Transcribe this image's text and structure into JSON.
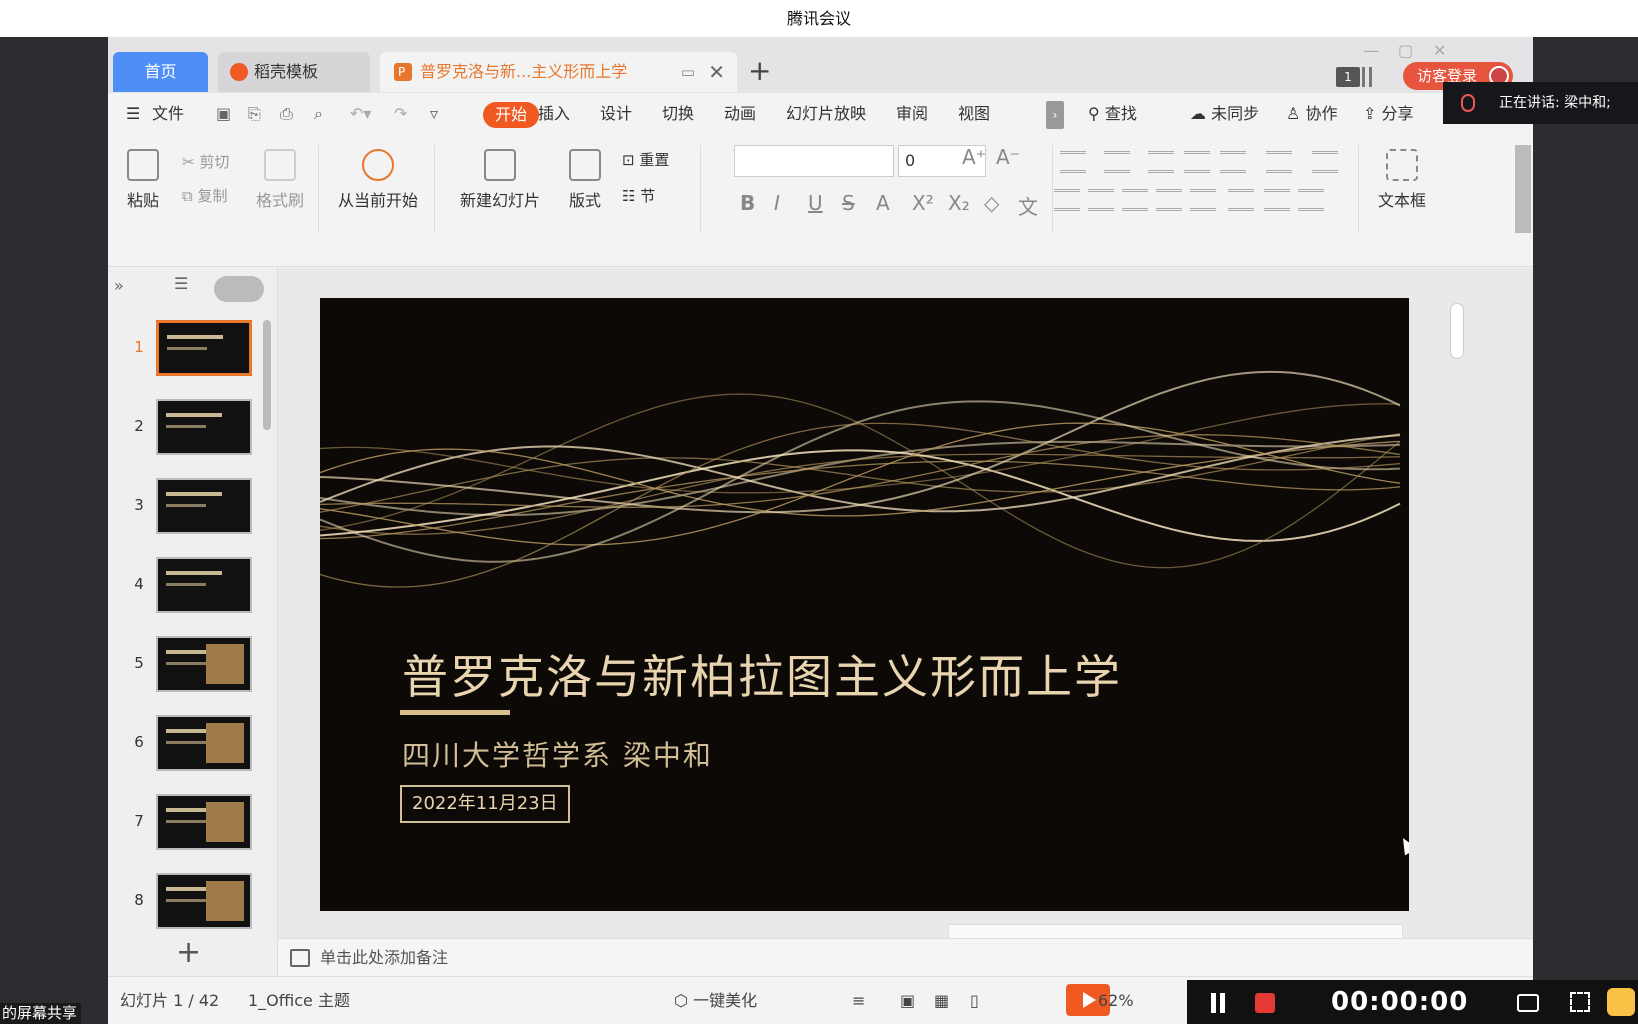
{
  "meeting": {
    "title": "腾讯会议",
    "speaking": "正在讲话: 梁中和;",
    "share_label": "的屏幕共享",
    "timer": "00:00:00"
  },
  "tabs": {
    "home": "首页",
    "template": "稻壳模板",
    "document": "普罗克洛与新...主义形而上学",
    "badge": "1",
    "guest_login": "访客登录"
  },
  "menu": {
    "file": "文件",
    "items": [
      "开始",
      "插入",
      "设计",
      "切换",
      "动画",
      "幻灯片放映",
      "审阅",
      "视图"
    ],
    "search": "查找",
    "sync": "未同步",
    "collab": "协作",
    "share": "分享"
  },
  "ribbon": {
    "paste": "粘贴",
    "cut": "剪切",
    "copy": "复制",
    "format_painter": "格式刷",
    "from_current": "从当前开始",
    "new_slide": "新建幻灯片",
    "layout": "版式",
    "reset": "重置",
    "section": "节",
    "font_size": "0",
    "textbox": "文本框"
  },
  "slides": [
    {
      "num": "1"
    },
    {
      "num": "2"
    },
    {
      "num": "3"
    },
    {
      "num": "4"
    },
    {
      "num": "5"
    },
    {
      "num": "6"
    },
    {
      "num": "7"
    },
    {
      "num": "8"
    }
  ],
  "current_slide": {
    "title": "普罗克洛与新柏拉图主义形而上学",
    "subtitle": "四川大学哲学系  梁中和",
    "date": "2022年11月23日"
  },
  "notes_placeholder": "单击此处添加备注",
  "status": {
    "slide_counter": "幻灯片 1 / 42",
    "theme": "1_Office 主题",
    "beautify": "一键美化",
    "zoom": "62%"
  },
  "colors": {
    "accent": "#f05a22",
    "home_tab": "#4d8ef7",
    "slide_bg": "#0d0906",
    "slide_gold": "#e8d5b0"
  }
}
